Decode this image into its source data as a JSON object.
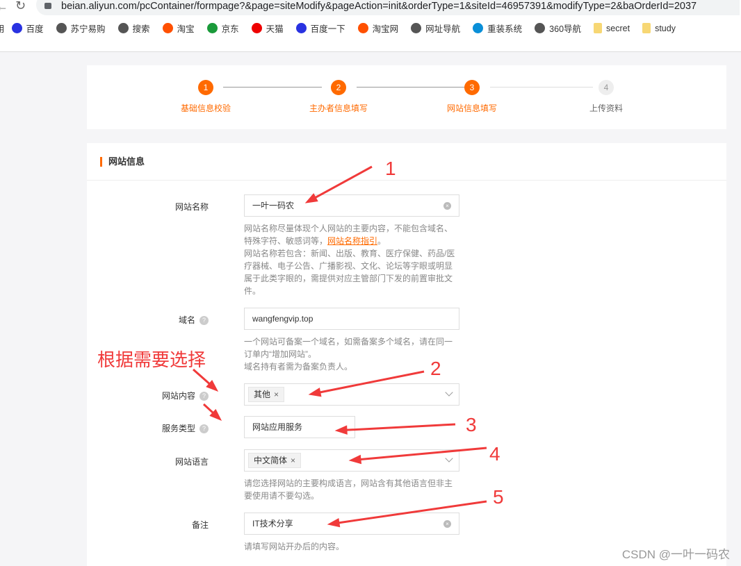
{
  "browser": {
    "url": "beian.aliyun.com/pcContainer/formpage?&page=siteModify&pageAction=init&orderType=1&siteId=46957391&modifyType=2&baOrderId=2037",
    "bookmarks": [
      {
        "label": "百度",
        "color": "#2932e1"
      },
      {
        "label": "苏宁易购",
        "color": "#555"
      },
      {
        "label": "搜索",
        "color": "#555"
      },
      {
        "label": "淘宝",
        "color": "#ff5000"
      },
      {
        "label": "京东",
        "color": "#1a9a3a"
      },
      {
        "label": "天猫",
        "color": "#e00"
      },
      {
        "label": "百度一下",
        "color": "#2932e1"
      },
      {
        "label": "淘宝网",
        "color": "#ff5000"
      },
      {
        "label": "网址导航",
        "color": "#555"
      },
      {
        "label": "重装系统",
        "color": "#0a8fd8"
      },
      {
        "label": "360导航",
        "color": "#555"
      },
      {
        "label": "secret",
        "color": "#f7d774"
      },
      {
        "label": "study",
        "color": "#f7d774"
      }
    ]
  },
  "steps": [
    {
      "num": "1",
      "label": "基础信息校验",
      "active": true
    },
    {
      "num": "2",
      "label": "主办者信息填写",
      "active": true
    },
    {
      "num": "3",
      "label": "网站信息填写",
      "active": true
    },
    {
      "num": "4",
      "label": "上传资料",
      "active": false
    }
  ],
  "accent": "#ff6a00",
  "form": {
    "section_title": "网站信息",
    "site_name": {
      "label": "网站名称",
      "value": "一叶一码农",
      "help1": "网站名称尽量体现个人网站的主要内容，不能包含域名、特殊字符、敏感词等，",
      "help_link": "网站名称指引",
      "help1_end": "。",
      "help2": "网站名称若包含：新闻、出版、教育、医疗保健、药品/医疗器械、电子公告、广播影视、文化、论坛等字眼或明显属于此类字眼的，需提供对应主管部门下发的前置审批文件。"
    },
    "domain": {
      "label": "域名",
      "value": "wangfengvip.top",
      "help1": "一个网站可备案一个域名，如需备案多个域名，请在同一订单内“增加网站”。",
      "help2": "域名持有者需为备案负责人。"
    },
    "content": {
      "label": "网站内容",
      "tag": "其他"
    },
    "service": {
      "label": "服务类型",
      "value": "网站应用服务"
    },
    "language": {
      "label": "网站语言",
      "tag": "中文简体",
      "help": "请您选择网站的主要构成语言，网站含有其他语言但非主要使用请不要勾选。"
    },
    "remark": {
      "label": "备注",
      "value": "IT技术分享",
      "help": "请填写网站开办后的内容。"
    }
  },
  "annotations": {
    "n1": "1",
    "n2": "2",
    "n3": "3",
    "n4": "4",
    "n5": "5",
    "note": "根据需要选择",
    "color": "#f03a3a"
  },
  "watermark": "CSDN @一叶一码农"
}
